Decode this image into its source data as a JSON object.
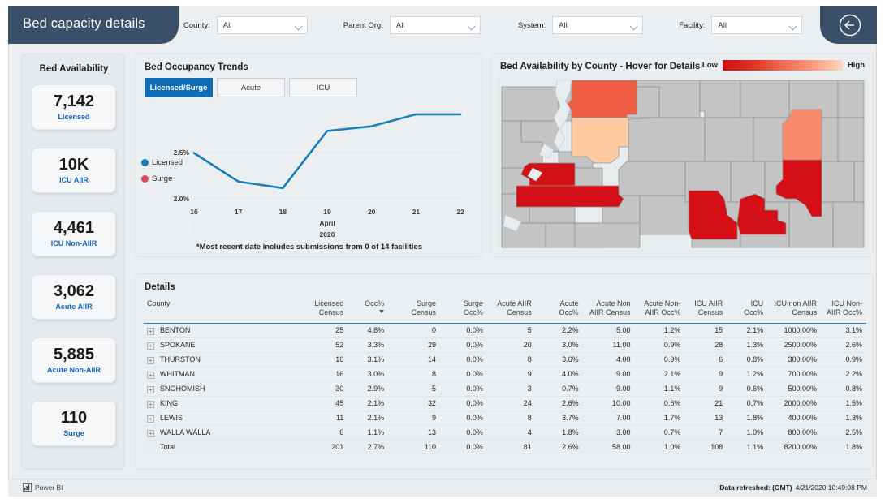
{
  "header": {
    "title": "Bed capacity details",
    "back_icon": "back-arrow-circle-icon",
    "filters": [
      {
        "label": "County:",
        "value": "All",
        "icon": "chevron-down-icon"
      },
      {
        "label": "Parent Org:",
        "value": "All",
        "icon": "chevron-down-icon"
      },
      {
        "label": "System:",
        "value": "All",
        "icon": "chevron-down-icon"
      },
      {
        "label": "Facility:",
        "value": "All",
        "icon": "chevron-down-icon"
      }
    ]
  },
  "kpi_rail": {
    "title": "Bed Availability",
    "accent_color": "#1464c0",
    "cards": [
      {
        "value": "7,142",
        "label": "Licensed"
      },
      {
        "value": "10K",
        "label": "ICU AIIR"
      },
      {
        "value": "4,461",
        "label": "ICU Non-AIIR"
      },
      {
        "value": "3,062",
        "label": "Acute AIIR"
      },
      {
        "value": "5,885",
        "label": "Acute Non-AIIR"
      },
      {
        "value": "110",
        "label": "Surge"
      }
    ]
  },
  "trends": {
    "title": "Bed Occupancy Trends",
    "tabs": [
      {
        "label": "Licensed/Surge",
        "active": true
      },
      {
        "label": "Acute",
        "active": false
      },
      {
        "label": "ICU",
        "active": false
      }
    ],
    "active_tab_color": "#0f6cb5",
    "note": "*Most recent date includes submissions from 0 of 14 facilities"
  },
  "chart_data": {
    "type": "line",
    "title": "Bed Occupancy Trends",
    "xlabel": "April 2020",
    "ylabel": "",
    "x": [
      "16",
      "17",
      "18",
      "19",
      "20",
      "21",
      "22"
    ],
    "x_axis_caption_1": "April",
    "x_axis_caption_2": "2020",
    "ytick_labels": [
      "2.0%",
      "2.5%"
    ],
    "ylim": [
      1.95,
      3.05
    ],
    "grid": true,
    "legend_position": "left",
    "series": [
      {
        "name": "Licensed",
        "color": "#1b7fb8",
        "values": [
          2.49,
          2.18,
          2.11,
          2.73,
          2.78,
          2.91,
          2.91
        ]
      },
      {
        "name": "Surge",
        "color": "#e04a57",
        "values": []
      }
    ]
  },
  "map": {
    "title": "Bed Availability by County - Hover for Details",
    "legend_low": "Low",
    "legend_high": "High",
    "gradient_low_color": "#cc1111",
    "gradient_high_color": "#ffd9bd",
    "base_county_color": "#c4c4c4",
    "water_color": "#e7ecef",
    "counties": [
      {
        "name": "SNOHOMISH",
        "color": "#ef5c42"
      },
      {
        "name": "KING",
        "color": "#ffcba3"
      },
      {
        "name": "SPOKANE",
        "color": "#fb8a6e"
      },
      {
        "name": "THURSTON",
        "color": "#d41016"
      },
      {
        "name": "LEWIS",
        "color": "#d41016"
      },
      {
        "name": "BENTON",
        "color": "#d41016"
      },
      {
        "name": "WALLA WALLA",
        "color": "#d41016"
      },
      {
        "name": "WHITMAN",
        "color": "#d41016"
      }
    ]
  },
  "details": {
    "title": "Details",
    "columns": [
      "County",
      "Licensed Census",
      "Occ%",
      "Surge Census",
      "Surge Occ%",
      "Acute AIIR Census",
      "Acute Occ%",
      "Acute Non AIIR Census",
      "Acute Non-AIIR Occ%",
      "ICU AIIR Census",
      "ICU Occ%",
      "ICU non AIIR Census",
      "ICU Non-AIIR Occ%"
    ],
    "sorted_column": "Occ%",
    "sort_direction": "desc",
    "rows": [
      {
        "county": "BENTON",
        "licensed_census": "25",
        "occ": "4.8%",
        "surge_census": "0",
        "surge_occ": "0.0%",
        "acute_aiir_census": "5",
        "acute_occ": "2.2%",
        "acute_non_aiir_census": "5.00",
        "acute_non_aiir_occ": "1.2%",
        "icu_aiir_census": "15",
        "icu_occ": "2.1%",
        "icu_non_aiir_census": "1000.00%",
        "icu_non_aiir_occ": "3.1%"
      },
      {
        "county": "SPOKANE",
        "licensed_census": "52",
        "occ": "3.3%",
        "surge_census": "29",
        "surge_occ": "0.0%",
        "acute_aiir_census": "20",
        "acute_occ": "3.0%",
        "acute_non_aiir_census": "11.00",
        "acute_non_aiir_occ": "0.9%",
        "icu_aiir_census": "28",
        "icu_occ": "1.3%",
        "icu_non_aiir_census": "2500.00%",
        "icu_non_aiir_occ": "2.6%"
      },
      {
        "county": "THURSTON",
        "licensed_census": "16",
        "occ": "3.1%",
        "surge_census": "14",
        "surge_occ": "0.0%",
        "acute_aiir_census": "8",
        "acute_occ": "3.6%",
        "acute_non_aiir_census": "4.00",
        "acute_non_aiir_occ": "0.9%",
        "icu_aiir_census": "6",
        "icu_occ": "0.8%",
        "icu_non_aiir_census": "300.00%",
        "icu_non_aiir_occ": "0.9%"
      },
      {
        "county": "WHITMAN",
        "licensed_census": "16",
        "occ": "3.0%",
        "surge_census": "8",
        "surge_occ": "0.0%",
        "acute_aiir_census": "9",
        "acute_occ": "4.0%",
        "acute_non_aiir_census": "9.00",
        "acute_non_aiir_occ": "2.1%",
        "icu_aiir_census": "9",
        "icu_occ": "1.2%",
        "icu_non_aiir_census": "700.00%",
        "icu_non_aiir_occ": "2.2%"
      },
      {
        "county": "SNOHOMISH",
        "licensed_census": "30",
        "occ": "2.9%",
        "surge_census": "5",
        "surge_occ": "0.0%",
        "acute_aiir_census": "3",
        "acute_occ": "0.7%",
        "acute_non_aiir_census": "9.00",
        "acute_non_aiir_occ": "1.1%",
        "icu_aiir_census": "9",
        "icu_occ": "0.6%",
        "icu_non_aiir_census": "500.00%",
        "icu_non_aiir_occ": "0.8%"
      },
      {
        "county": "KING",
        "licensed_census": "45",
        "occ": "2.1%",
        "surge_census": "32",
        "surge_occ": "0.0%",
        "acute_aiir_census": "24",
        "acute_occ": "2.6%",
        "acute_non_aiir_census": "10.00",
        "acute_non_aiir_occ": "0.6%",
        "icu_aiir_census": "21",
        "icu_occ": "0.7%",
        "icu_non_aiir_census": "2000.00%",
        "icu_non_aiir_occ": "1.5%"
      },
      {
        "county": "LEWIS",
        "licensed_census": "11",
        "occ": "2.1%",
        "surge_census": "9",
        "surge_occ": "0.0%",
        "acute_aiir_census": "8",
        "acute_occ": "3.7%",
        "acute_non_aiir_census": "7.00",
        "acute_non_aiir_occ": "1.7%",
        "icu_aiir_census": "13",
        "icu_occ": "1.8%",
        "icu_non_aiir_census": "400.00%",
        "icu_non_aiir_occ": "1.3%"
      },
      {
        "county": "WALLA WALLA",
        "licensed_census": "6",
        "occ": "1.1%",
        "surge_census": "13",
        "surge_occ": "0.0%",
        "acute_aiir_census": "4",
        "acute_occ": "1.8%",
        "acute_non_aiir_census": "3.00",
        "acute_non_aiir_occ": "0.7%",
        "icu_aiir_census": "7",
        "icu_occ": "1.0%",
        "icu_non_aiir_census": "800.00%",
        "icu_non_aiir_occ": "2.5%"
      }
    ],
    "total": {
      "county": "Total",
      "licensed_census": "201",
      "occ": "2.7%",
      "surge_census": "110",
      "surge_occ": "0.0%",
      "acute_aiir_census": "81",
      "acute_occ": "2.6%",
      "acute_non_aiir_census": "58.00",
      "acute_non_aiir_occ": "1.0%",
      "icu_aiir_census": "108",
      "icu_occ": "1.1%",
      "icu_non_aiir_census": "8200.00%",
      "icu_non_aiir_occ": "1.8%"
    }
  },
  "footer": {
    "brand": "Power BI",
    "refresh_label": "Data refreshed: (GMT)",
    "refresh_timestamp": "4/21/2020 10:49:08 PM"
  }
}
